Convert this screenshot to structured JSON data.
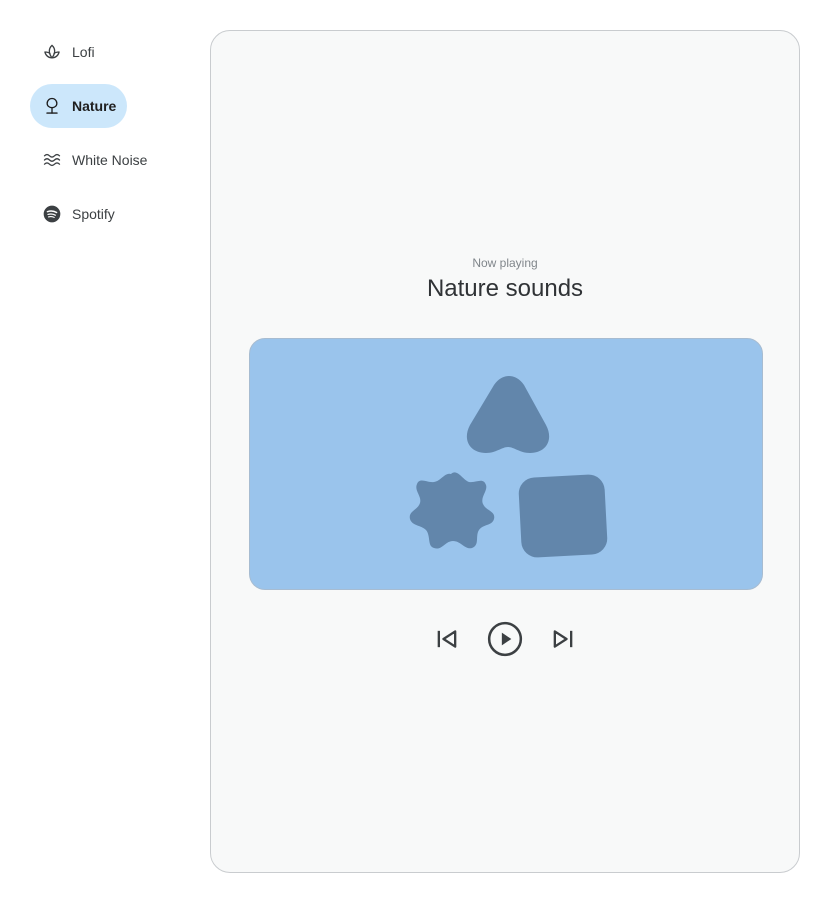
{
  "nav": {
    "items": [
      {
        "label": "Lofi",
        "icon": "lotus-icon"
      },
      {
        "label": "Nature",
        "icon": "tree-icon",
        "active": true
      },
      {
        "label": "White Noise",
        "icon": "waves-icon"
      },
      {
        "label": "Spotify",
        "icon": "spotify-icon"
      }
    ]
  },
  "player": {
    "now_playing_label": "Now playing",
    "title": "Nature sounds"
  },
  "colors": {
    "active_pill": "#cce7fb",
    "art_background": "#9ac4ec",
    "art_shapes": "#6286ab"
  }
}
